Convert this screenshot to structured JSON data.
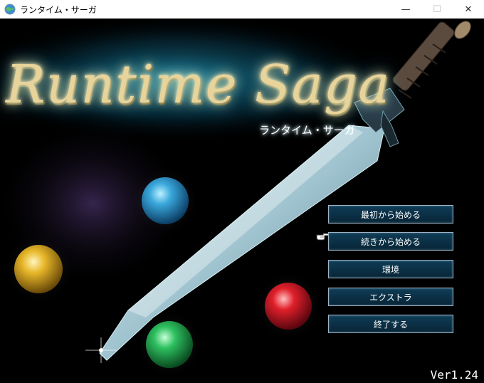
{
  "window": {
    "title": "ランタイム・サーガ",
    "minimize_glyph": "—",
    "maximize_glyph": "☐",
    "close_glyph": "✕"
  },
  "game": {
    "logo": "Runtime Saga",
    "subtitle": "ランタイム・サーガ",
    "menu": [
      {
        "label": "最初から始める"
      },
      {
        "label": "続きから始める"
      },
      {
        "label": "環境"
      },
      {
        "label": "エクストラ"
      },
      {
        "label": "終了する"
      }
    ],
    "selected_index": 1,
    "cursor_icon": "pointing-hand-icon",
    "version": "Ver1.24"
  },
  "colors": {
    "menu_bg": "#0b3048",
    "menu_border": "#9fb3c3",
    "orb_blue": "#2fa0d8",
    "orb_yellow": "#e8b82a",
    "orb_red": "#e0202a",
    "orb_green": "#2ec060"
  }
}
